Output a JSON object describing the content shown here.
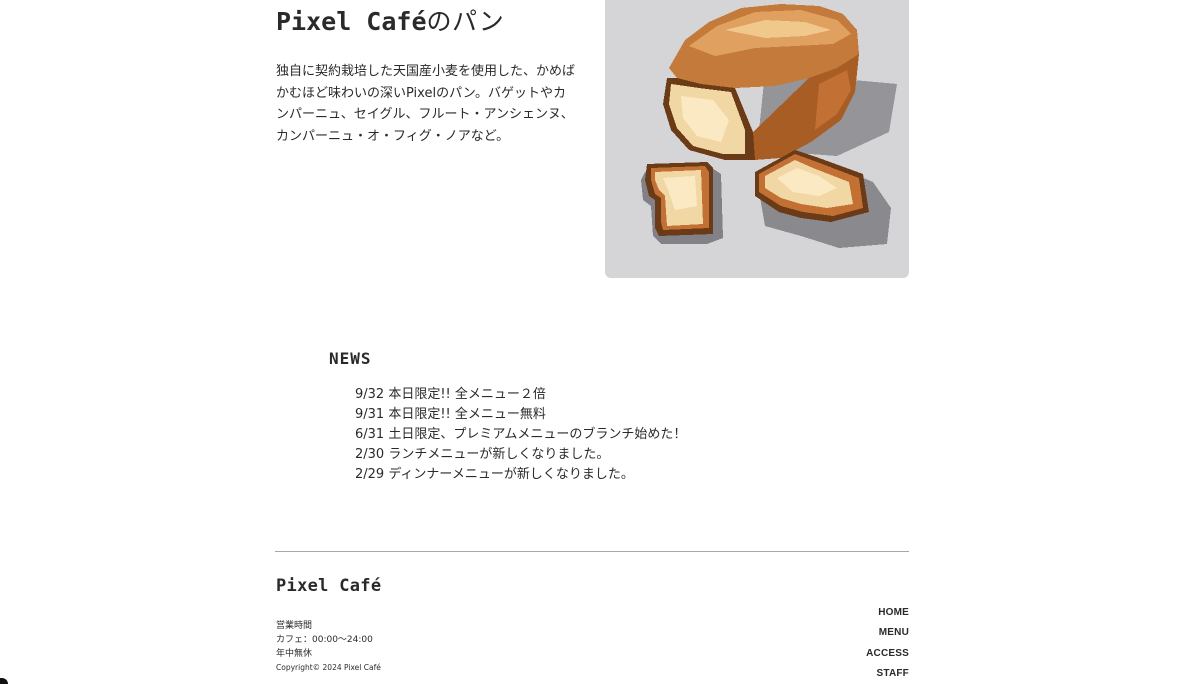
{
  "intro": {
    "title_brand": "Pixel Café",
    "title_suffix": "のパン",
    "description_lines": [
      "独自に契約栽培した天国産小麦を使用した、かめば",
      "かむほど味わいの深いPixelのパン。バゲットやカ",
      "ンパーニュ、セイグル、フルート・アンシェンヌ、",
      "カンパーニュ・オ・フィグ・ノアなど。"
    ]
  },
  "news": {
    "heading": "NEWS",
    "items": [
      "9/32 本日限定!! 全メニュー２倍",
      "9/31 本日限定!! 全メニュー無料",
      "6/31 土日限定、プレミアムメニューのブランチ始めた！",
      "2/30 ランチメニューが新しくなりました。",
      "2/29 ディンナーメニューが新しくなりました。"
    ]
  },
  "footer": {
    "logo": "Pixel Café",
    "hours_lines": [
      "営業時間",
      "カフェ：00:00〜24:00",
      "年中無休"
    ],
    "copyright": "Copyright© 2024 Pixel Café",
    "nav": [
      "HOME",
      "MENU",
      "ACCESS",
      "STAFF"
    ]
  },
  "colors": {
    "text": "#2a2a2a",
    "image_background": "#d5d5d7",
    "divider": "#a8a8a8"
  }
}
